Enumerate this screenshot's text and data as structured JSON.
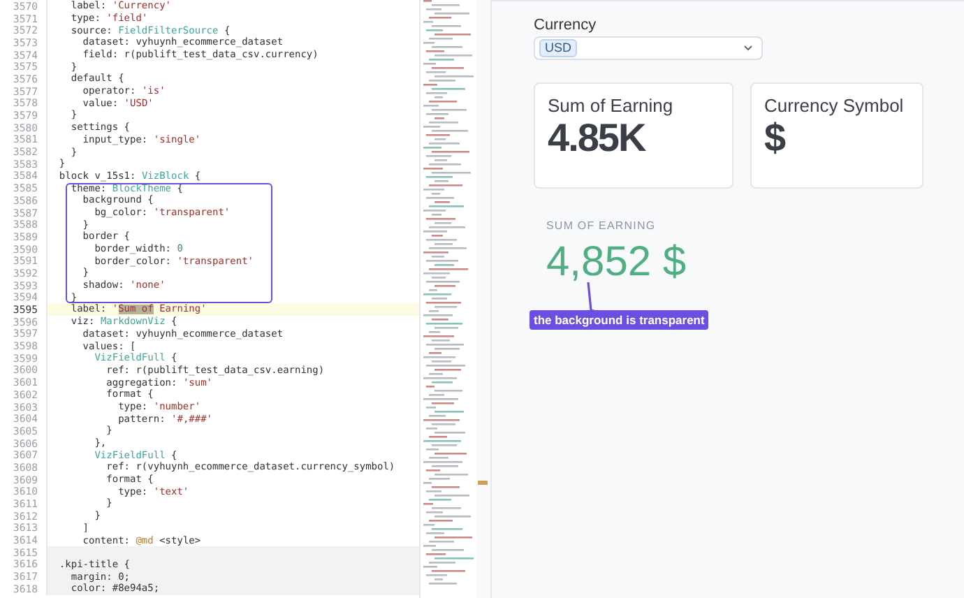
{
  "editor": {
    "lines": [
      {
        "number": "3570",
        "current": false,
        "embedded": false,
        "framed": false,
        "parts": [
          {
            "kind": "text",
            "text": "    label: "
          },
          {
            "kind": "string",
            "text": "'Currency'"
          }
        ]
      },
      {
        "number": "3571",
        "current": false,
        "embedded": false,
        "framed": false,
        "parts": [
          {
            "kind": "text",
            "text": "    type: "
          },
          {
            "kind": "string",
            "text": "'field'"
          }
        ]
      },
      {
        "number": "3572",
        "current": false,
        "embedded": false,
        "framed": false,
        "parts": [
          {
            "kind": "text",
            "text": "    source: "
          },
          {
            "kind": "type",
            "text": "FieldFilterSource"
          },
          {
            "kind": "text",
            "text": " {"
          }
        ]
      },
      {
        "number": "3573",
        "current": false,
        "embedded": false,
        "framed": false,
        "parts": [
          {
            "kind": "text",
            "text": "      dataset: vyhuynh_ecommerce_dataset"
          }
        ]
      },
      {
        "number": "3574",
        "current": false,
        "embedded": false,
        "framed": false,
        "parts": [
          {
            "kind": "text",
            "text": "      field: r(publift_test_data_csv.currency)"
          }
        ]
      },
      {
        "number": "3575",
        "current": false,
        "embedded": false,
        "framed": false,
        "parts": [
          {
            "kind": "text",
            "text": "    }"
          }
        ]
      },
      {
        "number": "3576",
        "current": false,
        "embedded": false,
        "framed": false,
        "parts": [
          {
            "kind": "text",
            "text": "    default {"
          }
        ]
      },
      {
        "number": "3577",
        "current": false,
        "embedded": false,
        "framed": false,
        "parts": [
          {
            "kind": "text",
            "text": "      operator: "
          },
          {
            "kind": "string",
            "text": "'is'"
          }
        ]
      },
      {
        "number": "3578",
        "current": false,
        "embedded": false,
        "framed": false,
        "parts": [
          {
            "kind": "text",
            "text": "      value: "
          },
          {
            "kind": "string",
            "text": "'USD'"
          }
        ]
      },
      {
        "number": "3579",
        "current": false,
        "embedded": false,
        "framed": false,
        "parts": [
          {
            "kind": "text",
            "text": "    }"
          }
        ]
      },
      {
        "number": "3580",
        "current": false,
        "embedded": false,
        "framed": false,
        "parts": [
          {
            "kind": "text",
            "text": "    settings {"
          }
        ]
      },
      {
        "number": "3581",
        "current": false,
        "embedded": false,
        "framed": false,
        "parts": [
          {
            "kind": "text",
            "text": "      input_type: "
          },
          {
            "kind": "string",
            "text": "'single'"
          }
        ]
      },
      {
        "number": "3582",
        "current": false,
        "embedded": false,
        "framed": false,
        "parts": [
          {
            "kind": "text",
            "text": "    }"
          }
        ]
      },
      {
        "number": "3583",
        "current": false,
        "embedded": false,
        "framed": false,
        "parts": [
          {
            "kind": "text",
            "text": "  }"
          }
        ]
      },
      {
        "number": "3584",
        "current": false,
        "embedded": false,
        "framed": false,
        "parts": [
          {
            "kind": "text",
            "text": "  block v_15s1: "
          },
          {
            "kind": "type",
            "text": "VizBlock"
          },
          {
            "kind": "text",
            "text": " {"
          }
        ]
      },
      {
        "number": "3585",
        "current": false,
        "embedded": false,
        "framed": true,
        "parts": [
          {
            "kind": "text",
            "text": "    theme: "
          },
          {
            "kind": "type",
            "text": "BlockTheme"
          },
          {
            "kind": "text",
            "text": " {"
          }
        ]
      },
      {
        "number": "3586",
        "current": false,
        "embedded": false,
        "framed": true,
        "parts": [
          {
            "kind": "text",
            "text": "      background {"
          }
        ]
      },
      {
        "number": "3587",
        "current": false,
        "embedded": false,
        "framed": true,
        "parts": [
          {
            "kind": "text",
            "text": "        bg_color: "
          },
          {
            "kind": "string",
            "text": "'transparent'"
          }
        ]
      },
      {
        "number": "3588",
        "current": false,
        "embedded": false,
        "framed": true,
        "parts": [
          {
            "kind": "text",
            "text": "      }"
          }
        ]
      },
      {
        "number": "3589",
        "current": false,
        "embedded": false,
        "framed": true,
        "parts": [
          {
            "kind": "text",
            "text": "      border {"
          }
        ]
      },
      {
        "number": "3590",
        "current": false,
        "embedded": false,
        "framed": true,
        "parts": [
          {
            "kind": "text",
            "text": "        border_width: "
          },
          {
            "kind": "number",
            "text": "0"
          }
        ]
      },
      {
        "number": "3591",
        "current": false,
        "embedded": false,
        "framed": true,
        "parts": [
          {
            "kind": "text",
            "text": "        border_color: "
          },
          {
            "kind": "string",
            "text": "'transparent'"
          }
        ]
      },
      {
        "number": "3592",
        "current": false,
        "embedded": false,
        "framed": true,
        "parts": [
          {
            "kind": "text",
            "text": "      }"
          }
        ]
      },
      {
        "number": "3593",
        "current": false,
        "embedded": false,
        "framed": true,
        "parts": [
          {
            "kind": "text",
            "text": "      shadow: "
          },
          {
            "kind": "string",
            "text": "'none'"
          }
        ]
      },
      {
        "number": "3594",
        "current": false,
        "embedded": false,
        "framed": true,
        "parts": [
          {
            "kind": "text",
            "text": "    }"
          }
        ]
      },
      {
        "number": "3595",
        "current": true,
        "embedded": false,
        "framed": false,
        "parts": [
          {
            "kind": "text",
            "text": "    label: "
          },
          {
            "kind": "string",
            "text": "'"
          },
          {
            "kind": "match",
            "text": "Sum of"
          },
          {
            "kind": "string",
            "text": " Earning'"
          }
        ]
      },
      {
        "number": "3596",
        "current": false,
        "embedded": false,
        "framed": false,
        "parts": [
          {
            "kind": "text",
            "text": "    viz: "
          },
          {
            "kind": "type",
            "text": "MarkdownViz"
          },
          {
            "kind": "text",
            "text": " {"
          }
        ]
      },
      {
        "number": "3597",
        "current": false,
        "embedded": false,
        "framed": false,
        "parts": [
          {
            "kind": "text",
            "text": "      dataset: vyhuynh_ecommerce_dataset"
          }
        ]
      },
      {
        "number": "3598",
        "current": false,
        "embedded": false,
        "framed": false,
        "parts": [
          {
            "kind": "text",
            "text": "      values: ["
          }
        ]
      },
      {
        "number": "3599",
        "current": false,
        "embedded": false,
        "framed": false,
        "parts": [
          {
            "kind": "type",
            "text": "        VizFieldFull"
          },
          {
            "kind": "text",
            "text": " {"
          }
        ]
      },
      {
        "number": "3600",
        "current": false,
        "embedded": false,
        "framed": false,
        "parts": [
          {
            "kind": "text",
            "text": "          ref: r(publift_test_data_csv.earning)"
          }
        ]
      },
      {
        "number": "3601",
        "current": false,
        "embedded": false,
        "framed": false,
        "parts": [
          {
            "kind": "text",
            "text": "          aggregation: "
          },
          {
            "kind": "string",
            "text": "'sum'"
          }
        ]
      },
      {
        "number": "3602",
        "current": false,
        "embedded": false,
        "framed": false,
        "parts": [
          {
            "kind": "text",
            "text": "          format {"
          }
        ]
      },
      {
        "number": "3603",
        "current": false,
        "embedded": false,
        "framed": false,
        "parts": [
          {
            "kind": "text",
            "text": "            type: "
          },
          {
            "kind": "string",
            "text": "'number'"
          }
        ]
      },
      {
        "number": "3604",
        "current": false,
        "embedded": false,
        "framed": false,
        "parts": [
          {
            "kind": "text",
            "text": "            pattern: "
          },
          {
            "kind": "string",
            "text": "'#,###'"
          }
        ]
      },
      {
        "number": "3605",
        "current": false,
        "embedded": false,
        "framed": false,
        "parts": [
          {
            "kind": "text",
            "text": "          }"
          }
        ]
      },
      {
        "number": "3606",
        "current": false,
        "embedded": false,
        "framed": false,
        "parts": [
          {
            "kind": "text",
            "text": "        },"
          }
        ]
      },
      {
        "number": "3607",
        "current": false,
        "embedded": false,
        "framed": false,
        "parts": [
          {
            "kind": "type",
            "text": "        VizFieldFull"
          },
          {
            "kind": "text",
            "text": " {"
          }
        ]
      },
      {
        "number": "3608",
        "current": false,
        "embedded": false,
        "framed": false,
        "parts": [
          {
            "kind": "text",
            "text": "          ref: r(vyhuynh_ecommerce_dataset.currency_symbol)"
          }
        ]
      },
      {
        "number": "3609",
        "current": false,
        "embedded": false,
        "framed": false,
        "parts": [
          {
            "kind": "text",
            "text": "          format {"
          }
        ]
      },
      {
        "number": "3610",
        "current": false,
        "embedded": false,
        "framed": false,
        "parts": [
          {
            "kind": "text",
            "text": "            type: "
          },
          {
            "kind": "string",
            "text": "'text'"
          }
        ]
      },
      {
        "number": "3611",
        "current": false,
        "embedded": false,
        "framed": false,
        "parts": [
          {
            "kind": "text",
            "text": "          }"
          }
        ]
      },
      {
        "number": "3612",
        "current": false,
        "embedded": false,
        "framed": false,
        "parts": [
          {
            "kind": "text",
            "text": "        }"
          }
        ]
      },
      {
        "number": "3613",
        "current": false,
        "embedded": false,
        "framed": false,
        "parts": [
          {
            "kind": "text",
            "text": "      ]"
          }
        ]
      },
      {
        "number": "3614",
        "current": false,
        "embedded": false,
        "framed": false,
        "parts": [
          {
            "kind": "text",
            "text": "      content: "
          },
          {
            "kind": "keyword",
            "text": "@md"
          },
          {
            "kind": "text",
            "text": " <style>"
          }
        ]
      },
      {
        "number": "3615",
        "current": false,
        "embedded": true,
        "framed": false
      },
      {
        "number": "3616",
        "current": false,
        "embedded": true,
        "framed": false,
        "parts": [
          {
            "kind": "text",
            "text": "  .kpi-title {"
          }
        ]
      },
      {
        "number": "3617",
        "current": false,
        "embedded": true,
        "framed": false,
        "parts": [
          {
            "kind": "text",
            "text": "    margin: 0;"
          }
        ]
      },
      {
        "number": "3618",
        "current": false,
        "embedded": true,
        "framed": false,
        "parts": [
          {
            "kind": "text",
            "text": "    color: #8e94a5;"
          }
        ]
      }
    ]
  },
  "preview": {
    "filter": {
      "label": "Currency",
      "chip": "USD"
    },
    "cards": [
      {
        "title": "Sum of Earning",
        "value": "4.85K"
      },
      {
        "title": "Currency Symbol",
        "value": "$"
      }
    ],
    "transparent_kpi": {
      "title": "SUM OF EARNING",
      "value": "4,852 $"
    },
    "callout": "the background is transparent"
  }
}
